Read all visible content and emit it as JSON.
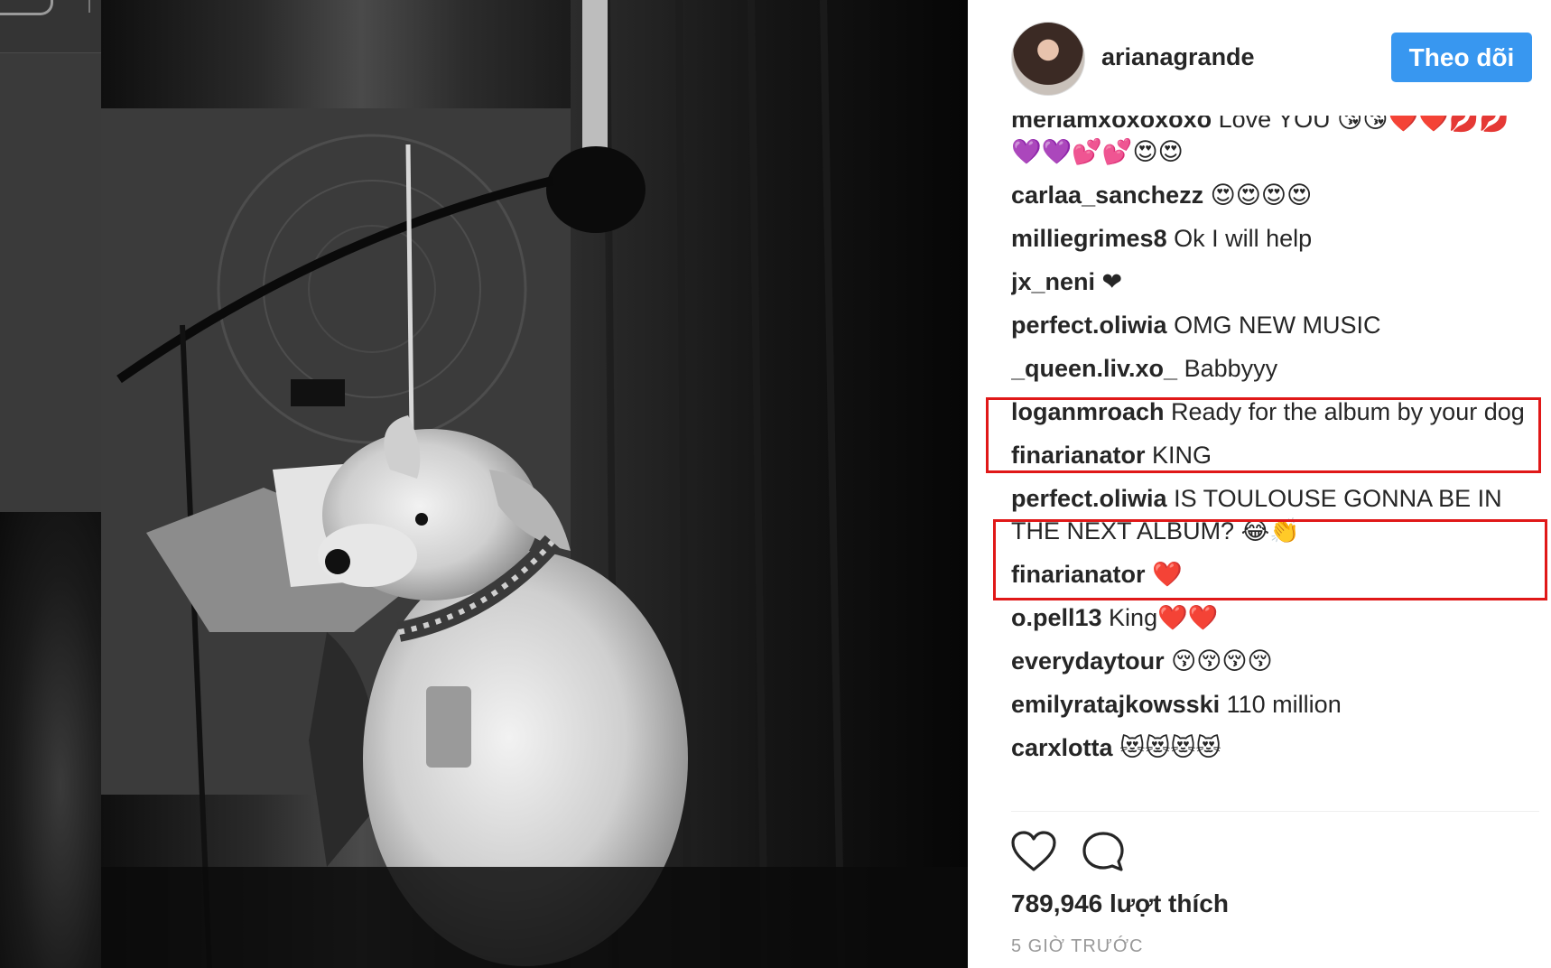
{
  "post": {
    "username": "arianagrande",
    "follow_label": "Theo dõi",
    "likes_text": "789,946 lượt thích",
    "time_text": "5 GIỜ TRƯỚC"
  },
  "comments": [
    {
      "user": "meriamxoxoxoxo",
      "text": "Love YOU 😘😘❤️❤️💋💋💜💜💕💕😍😍"
    },
    {
      "user": "carlaa_sanchezz",
      "text": "😍😍😍😍"
    },
    {
      "user": "milliegrimes8",
      "text": "Ok I will help"
    },
    {
      "user": "jx_neni",
      "text": "❤"
    },
    {
      "user": "perfect.oliwia",
      "text": "OMG NEW MUSIC"
    },
    {
      "user": "_queen.liv.xo_",
      "text": "Babbyyy"
    },
    {
      "user": "loganmroach",
      "text": "Ready for the album by your dog"
    },
    {
      "user": "finarianator",
      "text": "KING"
    },
    {
      "user": "perfect.oliwia",
      "text": "IS TOULOUSE GONNA BE IN THE NEXT ALBUM? 😂👏"
    },
    {
      "user": "finarianator",
      "text": "❤️"
    },
    {
      "user": "o.pell13",
      "text": "King❤️❤️"
    },
    {
      "user": "everydaytour",
      "text": "😚😚😚😚"
    },
    {
      "user": "emilyratajkowsski",
      "text": "110 million"
    },
    {
      "user": "carxlotta",
      "text": "😻😻😻😻"
    }
  ],
  "icons": {
    "like": "heart-icon",
    "comment": "comment-bubble-icon"
  },
  "colors": {
    "follow_button": "#3897f0",
    "highlight": "#e01818",
    "text": "#262626",
    "muted": "#999999"
  }
}
